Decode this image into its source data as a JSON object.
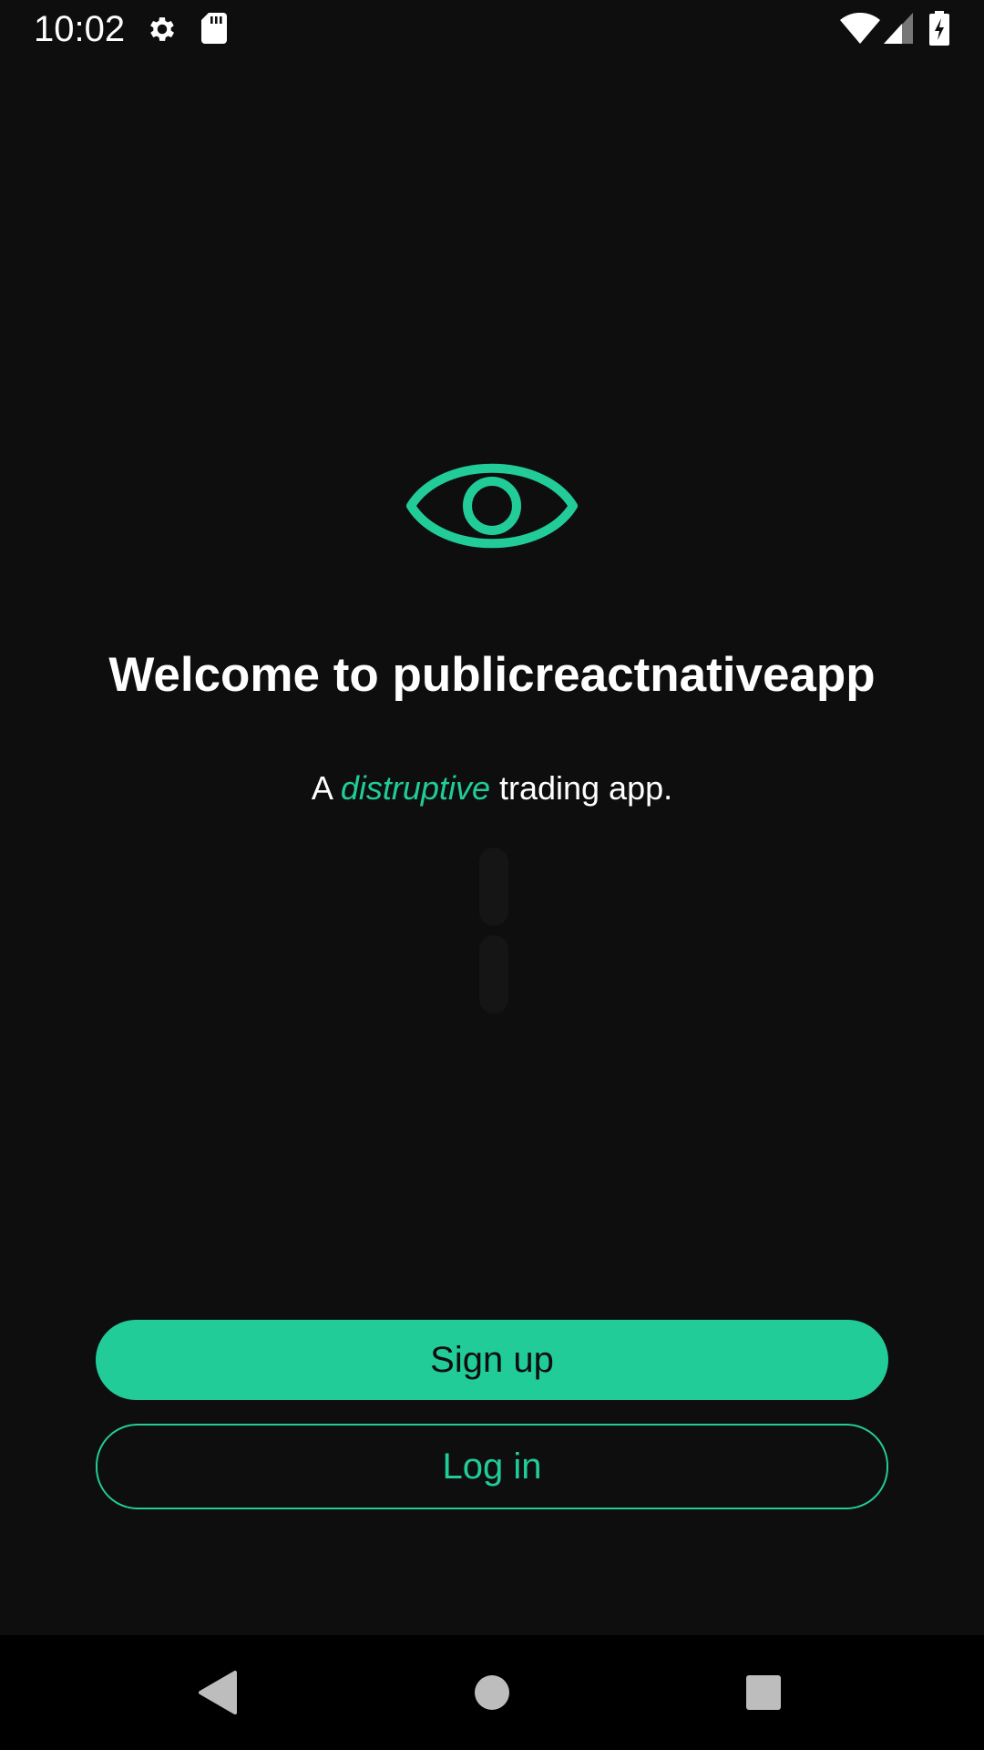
{
  "status_bar": {
    "time": "10:02",
    "icons": [
      "gear-icon",
      "sd-card-icon",
      "wifi-icon",
      "cell-signal-icon",
      "battery-charging-icon"
    ]
  },
  "welcome": {
    "logo_icon": "eye-icon",
    "title": "Welcome to publicreactnativeapp",
    "tagline_prefix": "A",
    "tagline_accent": "distruptive",
    "tagline_suffix": "trading app."
  },
  "actions": {
    "signup_label": "Sign up",
    "login_label": "Log in"
  },
  "nav_bar": {
    "icons": [
      "back-icon",
      "home-icon",
      "recents-icon"
    ]
  },
  "colors": {
    "background": "#0e0e0e",
    "accent": "#22cc99",
    "text": "#ffffff",
    "nav_background": "#000000"
  }
}
